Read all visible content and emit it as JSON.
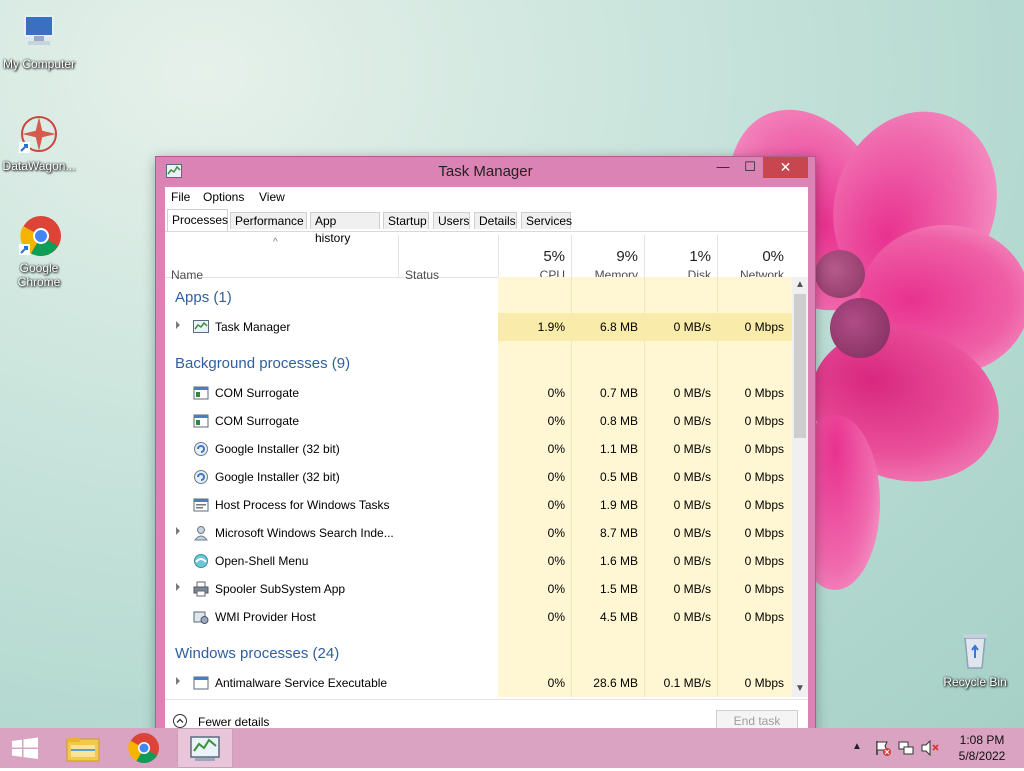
{
  "desktop": {
    "icons": [
      {
        "label": "My Computer"
      },
      {
        "label": "DataWagon..."
      },
      {
        "label": "Google Chrome"
      },
      {
        "label": "Recycle Bin"
      }
    ]
  },
  "window": {
    "title": "Task Manager",
    "minimize_glyph": "—",
    "maximize_glyph": "☐",
    "close_glyph": "✕"
  },
  "menu": [
    "File",
    "Options",
    "View"
  ],
  "tabs": [
    "Processes",
    "Performance",
    "App history",
    "Startup",
    "Users",
    "Details",
    "Services"
  ],
  "headers": {
    "sort_arrow": "^",
    "name": "Name",
    "status": "Status",
    "cpu": {
      "pct": "5%",
      "label": "CPU"
    },
    "memory": {
      "pct": "9%",
      "label": "Memory"
    },
    "disk": {
      "pct": "1%",
      "label": "Disk"
    },
    "network": {
      "pct": "0%",
      "label": "Network"
    }
  },
  "groups": [
    {
      "title": "Apps (1)"
    },
    {
      "title": "Background processes (9)"
    },
    {
      "title": "Windows processes (24)"
    }
  ],
  "processes": [
    {
      "name": "Task Manager",
      "cpu": "1.9%",
      "memory": "6.8 MB",
      "disk": "0 MB/s",
      "network": "0 Mbps",
      "icon": "task-manager-icon"
    },
    {
      "name": "COM Surrogate",
      "cpu": "0%",
      "memory": "0.7 MB",
      "disk": "0 MB/s",
      "network": "0 Mbps",
      "icon": "com-surrogate-icon"
    },
    {
      "name": "COM Surrogate",
      "cpu": "0%",
      "memory": "0.8 MB",
      "disk": "0 MB/s",
      "network": "0 Mbps",
      "icon": "com-surrogate-icon"
    },
    {
      "name": "Google Installer (32 bit)",
      "cpu": "0%",
      "memory": "1.1 MB",
      "disk": "0 MB/s",
      "network": "0 Mbps",
      "icon": "google-installer-icon"
    },
    {
      "name": "Google Installer (32 bit)",
      "cpu": "0%",
      "memory": "0.5 MB",
      "disk": "0 MB/s",
      "network": "0 Mbps",
      "icon": "google-installer-icon"
    },
    {
      "name": "Host Process for Windows Tasks",
      "cpu": "0%",
      "memory": "1.9 MB",
      "disk": "0 MB/s",
      "network": "0 Mbps",
      "icon": "host-process-icon"
    },
    {
      "name": "Microsoft Windows Search Inde...",
      "cpu": "0%",
      "memory": "8.7 MB",
      "disk": "0 MB/s",
      "network": "0 Mbps",
      "icon": "search-indexer-icon"
    },
    {
      "name": "Open-Shell Menu",
      "cpu": "0%",
      "memory": "1.6 MB",
      "disk": "0 MB/s",
      "network": "0 Mbps",
      "icon": "open-shell-icon"
    },
    {
      "name": "Spooler SubSystem App",
      "cpu": "0%",
      "memory": "1.5 MB",
      "disk": "0 MB/s",
      "network": "0 Mbps",
      "icon": "printer-icon"
    },
    {
      "name": "WMI Provider Host",
      "cpu": "0%",
      "memory": "4.5 MB",
      "disk": "0 MB/s",
      "network": "0 Mbps",
      "icon": "wmi-provider-icon"
    },
    {
      "name": "Antimalware Service Executable",
      "cpu": "0%",
      "memory": "28.6 MB",
      "disk": "0.1 MB/s",
      "network": "0 Mbps",
      "icon": "antimalware-icon"
    }
  ],
  "footer": {
    "fewer_details": "Fewer details",
    "end_task": "End task"
  },
  "taskbar": {
    "time": "1:08 PM",
    "date": "5/8/2022"
  },
  "colors": {
    "accent": "#dc83b6",
    "close": "#c7464f",
    "group_title": "#2f5f9e",
    "heat_light": "#fff7d4",
    "heat_mid": "#f9eba9"
  }
}
